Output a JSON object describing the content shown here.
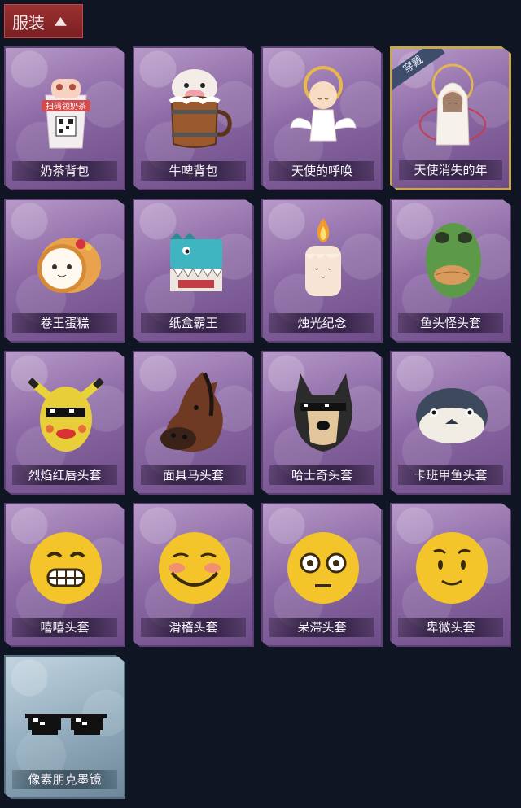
{
  "header": {
    "title": "服装"
  },
  "items": [
    {
      "label": "奶茶背包",
      "icon": "milk-tea-backpack-icon",
      "cup_text": "扫码领奶茶"
    },
    {
      "label": "牛啤背包",
      "icon": "beer-barrel-backpack-icon"
    },
    {
      "label": "天使的呼唤",
      "icon": "angel-call-icon"
    },
    {
      "label": "天使消失的年",
      "icon": "angel-vanished-year-icon",
      "badge": "穿戴"
    },
    {
      "label": "卷王蛋糕",
      "icon": "roll-cake-icon"
    },
    {
      "label": "纸盒霸王",
      "icon": "cardboard-dinosaur-icon"
    },
    {
      "label": "烛光纪念",
      "icon": "candle-icon"
    },
    {
      "label": "鱼头怪头套",
      "icon": "fish-head-mask-icon"
    },
    {
      "label": "烈焰红唇头套",
      "icon": "red-lips-mask-icon"
    },
    {
      "label": "面具马头套",
      "icon": "horse-head-mask-icon"
    },
    {
      "label": "哈士奇头套",
      "icon": "husky-head-mask-icon"
    },
    {
      "label": "卡班甲鱼头套",
      "icon": "fish-bun-mask-icon"
    },
    {
      "label": "嘻嘻头套",
      "icon": "grinning-emoji-mask-icon"
    },
    {
      "label": "滑稽头套",
      "icon": "smirk-emoji-mask-icon"
    },
    {
      "label": "呆滞头套",
      "icon": "dazed-emoji-mask-icon"
    },
    {
      "label": "卑微头套",
      "icon": "humble-emoji-mask-icon"
    },
    {
      "label": "像素朋克墨镜",
      "icon": "pixel-sunglasses-icon"
    }
  ],
  "colors": {
    "header_bg": "#8f2a2c",
    "card_bg": "#9a7ab3",
    "selected_border": "#c9a650",
    "page_bg": "#0f1522"
  }
}
